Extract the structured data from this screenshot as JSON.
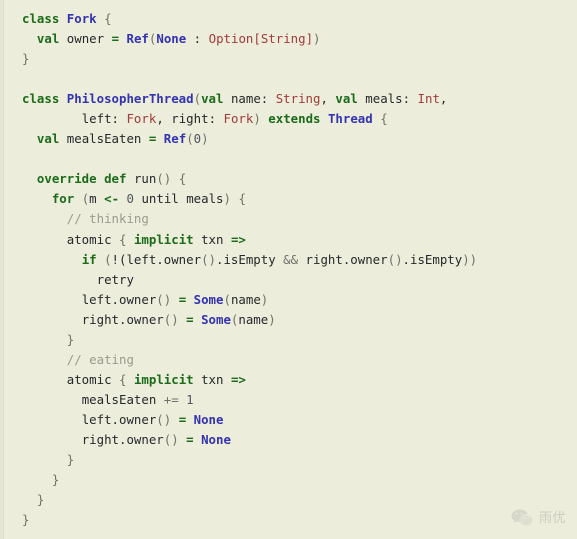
{
  "editor": {
    "language": "scala",
    "background_color": "#ecedda",
    "default_text_color": "#25282c",
    "theme_colors": {
      "keyword": "#1b6b1b",
      "type": "#3333b2",
      "type_annotation": "#a33a3a",
      "operator": "#1b6b1b",
      "comment": "#9a9a8f",
      "number": "#4f5560",
      "punctuation": "#6f7268"
    }
  },
  "code": {
    "lines": [
      "class Fork {",
      "  val owner = Ref(None : Option[String])",
      "}",
      "",
      "class PhilosopherThread(val name: String, val meals: Int,",
      "        left: Fork, right: Fork) extends Thread {",
      "  val mealsEaten = Ref(0)",
      "",
      "  override def run() {",
      "    for (m <- 0 until meals) {",
      "      // thinking",
      "      atomic { implicit txn =>",
      "        if (!(left.owner().isEmpty && right.owner().isEmpty))",
      "          retry",
      "        left.owner() = Some(name)",
      "        right.owner() = Some(name)",
      "      }",
      "      // eating",
      "      atomic { implicit txn =>",
      "        mealsEaten += 1",
      "        left.owner() = None",
      "        right.owner() = None",
      "      }",
      "    }",
      "  }",
      "}"
    ]
  },
  "watermark": {
    "icon_name": "wechat-icon",
    "text": "雨优",
    "color": "#b9bab0"
  }
}
